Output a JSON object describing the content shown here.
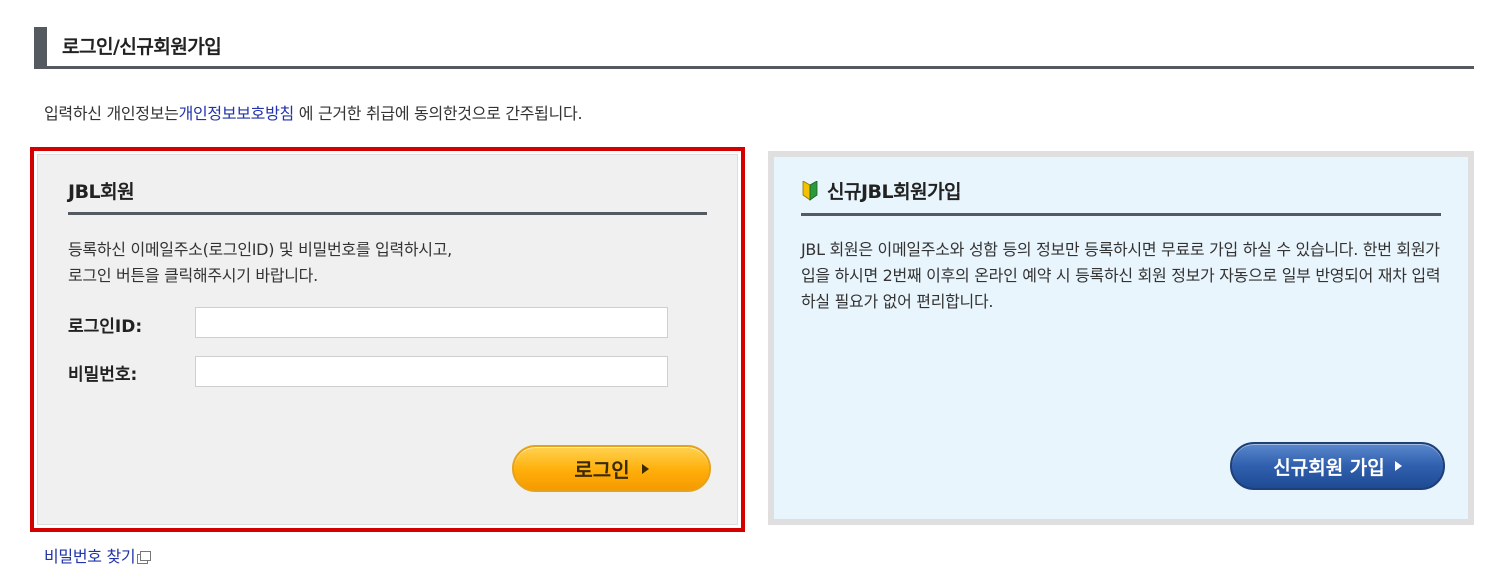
{
  "header": {
    "title": "로그인/신규회원가입"
  },
  "notice": {
    "prefix": "입력하신 개인정보는",
    "link": "개인정보보호방침",
    "suffix": " 에 근거한 취급에 동의한것으로 간주됩니다."
  },
  "login": {
    "title": "JBL회원",
    "description_line1": "등록하신 이메일주소(로그인ID) 및 비밀번호를 입력하시고,",
    "description_line2": "로그인 버튼을 클릭해주시기 바랍니다.",
    "id_label": "로그인ID:",
    "id_value": "",
    "password_label": "비밀번호:",
    "password_value": "",
    "button_label": "로그인",
    "forgot_password": "비밀번호 찾기"
  },
  "signup": {
    "title": "신규JBL회원가입",
    "description": "JBL 회원은 이메일주소와 성함 등의 정보만 등록하시면 무료로 가입 하실 수 있습니다. 한번 회원가입을 하시면 2번째 이후의 온라인 예약 시 등록하신 회원 정보가 자동으로 일부 반영되어 재차 입력하실 필요가 없어 편리합니다.",
    "button_label": "신규회원 가입"
  },
  "icons": {
    "login_arrow": "arrow-right-icon",
    "signup_arrow": "arrow-right-icon",
    "signup_badge": "beginner-leaf-icon",
    "forgot_external": "external-window-icon"
  },
  "colors": {
    "highlight": "#d40000",
    "link": "#2233aa",
    "login_button": "#ffae0a",
    "signup_button": "#2f5fae",
    "signup_panel": "#e9f5fd",
    "header_bar": "#555a60"
  }
}
